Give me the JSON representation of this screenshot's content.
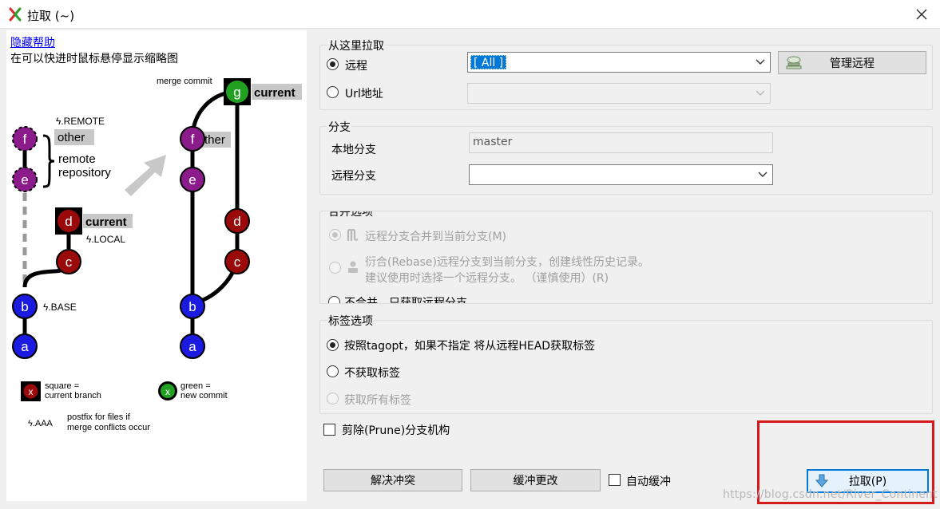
{
  "window": {
    "title": "拉取 (~)",
    "close_label": "✕"
  },
  "help": {
    "link": "隐藏帮助",
    "text": "在可以快进时鼠标悬停显示缩略图"
  },
  "diagram": {
    "labels": {
      "remote_tag": "ϟ.REMOTE",
      "other": "other",
      "remote_repo_1": "remote",
      "remote_repo_2": "repository",
      "current": "current",
      "local_tag": "ϟ.LOCAL",
      "base_tag": "ϟ.BASE",
      "merge_commit": "merge commit",
      "other_right": "ther",
      "current_right": "current"
    },
    "nodes": {
      "a": "a",
      "b": "b",
      "c": "c",
      "d": "d",
      "e": "e",
      "f": "f",
      "g": "g"
    },
    "legend": {
      "square_mark": "x",
      "square_1": "square =",
      "square_2": "current branch",
      "green_mark": "x",
      "green_1": "green =",
      "green_2": "new commit",
      "postfix_tag": "ϟ.AAA",
      "postfix_1": "postfix for files if",
      "postfix_2": "merge conflicts occur"
    },
    "colors": {
      "purple": "#8b1a8b",
      "darkred": "#9b0a0a",
      "blue": "#1a1ae0",
      "green": "#22a022",
      "gray_arrow": "#c8c8c8"
    }
  },
  "pull_from": {
    "title": "从这里拉取",
    "remote_label": "远程",
    "remote_value": "[ All ]",
    "url_label": "Url地址",
    "url_value": "",
    "manage_button": "管理远程",
    "remote_checked": true
  },
  "branch": {
    "title": "分支",
    "local_label": "本地分支",
    "local_value": "master",
    "remote_label": "远程分支",
    "remote_value": ""
  },
  "merge_options": {
    "title": "合并选项",
    "merge_label": "远程分支合并到当前分支(M)",
    "rebase_line1": "衍合(Rebase)远程分支到当前分支，创建线性历史记录。",
    "rebase_line2": "建议使用时选择一个远程分支。 （谨慎使用）(R)",
    "fetch_only_label": "不合并，只获取远程分支"
  },
  "tag_options": {
    "title": "标签选项",
    "follow_label": "按照tagopt，如果不指定 将从远程HEAD获取标签",
    "no_tags_label": "不获取标签",
    "all_tags_label": "获取所有标签"
  },
  "prune": {
    "label": "剪除(Prune)分支机构"
  },
  "buttons": {
    "resolve": "解决冲突",
    "stash": "缓冲更改",
    "auto_stash": "自动缓冲",
    "pull": "拉取(P)"
  },
  "watermark": "https://blog.csdn.net/River_Continent",
  "accent_colors": {
    "highlight": "#0078d7",
    "annotation_red": "#d41a1a"
  }
}
